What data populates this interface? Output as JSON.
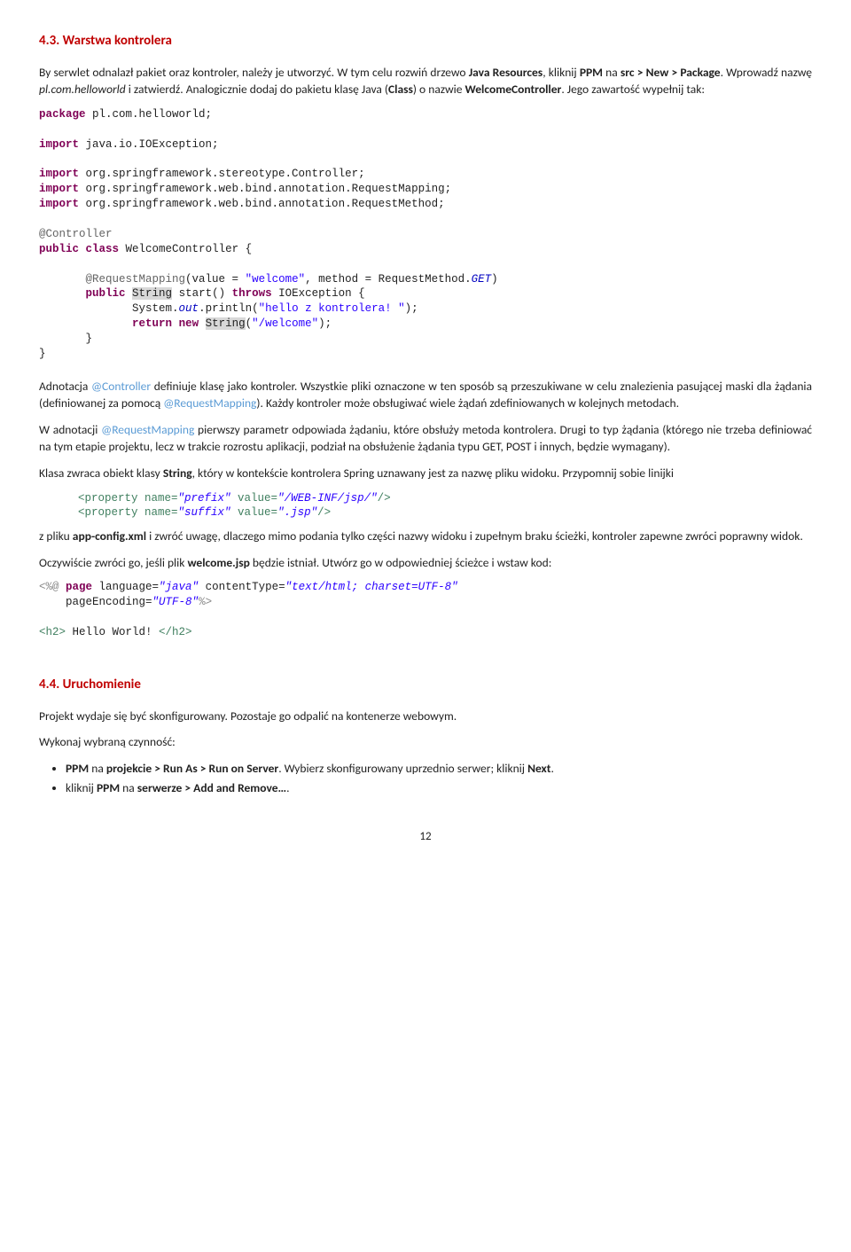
{
  "section43": {
    "num": "4.3.",
    "title": "Warstwa kontrolera",
    "p1a": "By serwlet odnalazł pakiet oraz kontroler, należy je utworzyć. W tym celu rozwiń drzewo ",
    "p1b": "Java Resources",
    "p1c": ", kliknij ",
    "p1d": "PPM",
    "p1e": " na ",
    "p1f": "src > New > Package",
    "p1g": ". Wprowadź nazwę ",
    "p1h": "pl.com.helloworld",
    "p1i": " i zatwierdź. Analogicznie dodaj do pakietu klasę Java (",
    "p1j": "Class",
    "p1k": ") o nazwie ",
    "p1l": "WelcomeController",
    "p1m": ". Jego zawartość wypełnij tak:"
  },
  "code1": {
    "l1_kw": "package",
    "l1_rest": " pl.com.helloworld;",
    "l2_kw": "import",
    "l2_rest": " java.io.IOException;",
    "l3_kw": "import",
    "l3_rest": " org.springframework.stereotype.Controller;",
    "l4_kw": "import",
    "l4_rest": " org.springframework.web.bind.annotation.RequestMapping;",
    "l5_kw": "import",
    "l5_rest": " org.springframework.web.bind.annotation.RequestMethod;",
    "l6_ann": "@Controller",
    "l7_kw1": "public",
    "l7_kw2": "class",
    "l7_rest": " WelcomeController {",
    "l8_ann": "@RequestMapping",
    "l8_a": "(value = ",
    "l8_s1": "\"welcome\"",
    "l8_b": ", method = RequestMethod.",
    "l8_it": "GET",
    "l8_c": ")",
    "l9_kw1": "public",
    "l9_hl1": "String",
    "l9_a": " start() ",
    "l9_kw2": "throws",
    "l9_b": " IOException {",
    "l10_a": "System.",
    "l10_it": "out",
    "l10_b": ".println(",
    "l10_s": "\"hello z kontrolera! \"",
    "l10_c": ");",
    "l11_kw1": "return",
    "l11_kw2": "new",
    "l11_hl": "String",
    "l11_a": "(",
    "l11_s": "\"/welcome\"",
    "l11_b": ");",
    "l12": "}",
    "l13": "}"
  },
  "para2": {
    "a": "Adnotacja ",
    "b": "@Controller",
    "c": " definiuje klasę jako kontroler. Wszystkie pliki oznaczone w ten sposób są przeszukiwane w celu znalezienia pasującej maski dla żądania (definiowanej za pomocą ",
    "d": "@RequestMapping",
    "e": "). Każdy kontroler może obsługiwać wiele żądań zdefiniowanych w kolejnych metodach."
  },
  "para3": {
    "a": "W adnotacji ",
    "b": "@RequestMapping",
    "c": " pierwszy parametr odpowiada żądaniu, które obsłuży metoda kontrolera. Drugi to typ żądania (którego nie trzeba definiować na tym etapie projektu, lecz w trakcie rozrostu aplikacji, podział na obsłużenie żądania typu GET, POST i innych, będzie wymagany)."
  },
  "para4": {
    "a": "Klasa zwraca obiekt klasy ",
    "b": "String",
    "c": ", który w kontekście kontrolera Spring uznawany jest za nazwę pliku widoku. Przypomnij sobie linijki"
  },
  "code2": {
    "l1a": "<property name=",
    "l1s1": "\"prefix\"",
    "l1b": " value=",
    "l1s2": "\"/WEB-INF/jsp/\"",
    "l1c": "/>",
    "l2a": "<property name=",
    "l2s1": "\"suffix\"",
    "l2b": " value=",
    "l2s2": "\".jsp\"",
    "l2c": "/>"
  },
  "para5": {
    "a": "z pliku ",
    "b": "app-config.xml",
    "c": " i zwróć uwagę, dlaczego mimo podania tylko części nazwy widoku i zupełnym braku ścieżki, kontroler zapewne zwróci poprawny widok."
  },
  "para6": {
    "a": "Oczywiście zwróci go, jeśli plik ",
    "b": "welcome.jsp",
    "c": " będzie istniał. Utwórz go w odpowiedniej ścieżce i wstaw kod:"
  },
  "code3": {
    "l1a": "<%@ ",
    "l1b": "page",
    "l1c": " language=",
    "l1s1": "\"java\"",
    "l1d": " contentType=",
    "l1s2": "\"text/html; charset=UTF-8\"",
    "l2a": "pageEncoding=",
    "l2s1": "\"UTF-8\"",
    "l2b": "%>",
    "l3a": "<h2>",
    "l3b": " Hello World! ",
    "l3c": "</h2>"
  },
  "section44": {
    "num": "4.4.",
    "title": "Uruchomienie",
    "p1": "Projekt wydaje się być skonfigurowany. Pozostaje go odpalić na kontenerze webowym.",
    "p2": "Wykonaj wybraną czynność:",
    "b1a": "PPM",
    "b1b": " na ",
    "b1c": "projekcie > Run As > Run on Server",
    "b1d": ". Wybierz skonfigurowany uprzednio serwer; kliknij ",
    "b1e": "Next",
    "b1f": ".",
    "b2a": "kliknij ",
    "b2b": "PPM",
    "b2c": " na ",
    "b2d": "serwerze > Add and Remove…",
    "b2e": "."
  },
  "pagenum": "12"
}
